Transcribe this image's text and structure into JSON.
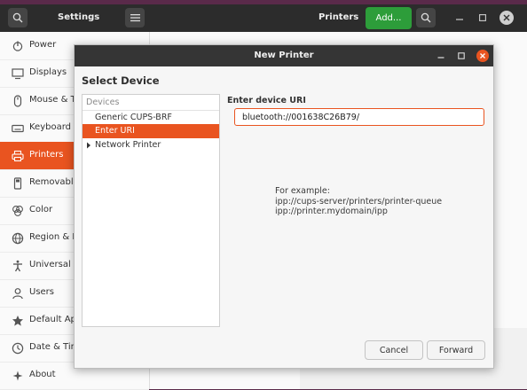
{
  "settings": {
    "title": "Settings",
    "page_title": "Printers",
    "add_label": "Add...",
    "sidebar": [
      {
        "label": "Power",
        "icon": "power-icon"
      },
      {
        "label": "Displays",
        "icon": "display-icon"
      },
      {
        "label": "Mouse & To",
        "icon": "mouse-icon"
      },
      {
        "label": "Keyboard S",
        "icon": "keyboard-icon"
      },
      {
        "label": "Printers",
        "icon": "printer-icon",
        "active": true
      },
      {
        "label": "Removable",
        "icon": "removable-media-icon"
      },
      {
        "label": "Color",
        "icon": "color-icon"
      },
      {
        "label": "Region & La",
        "icon": "region-icon"
      },
      {
        "label": "Universal A",
        "icon": "accessibility-icon"
      },
      {
        "label": "Users",
        "icon": "users-icon"
      },
      {
        "label": "Default Ap",
        "icon": "star-icon"
      },
      {
        "label": "Date & Tim",
        "icon": "clock-icon"
      },
      {
        "label": "About",
        "icon": "plus-icon"
      }
    ]
  },
  "dialog": {
    "title": "New Printer",
    "select_heading": "Select Device",
    "devices_header": "Devices",
    "devices": [
      {
        "label": "Generic CUPS-BRF"
      },
      {
        "label": "Enter URI",
        "selected": true
      },
      {
        "label": "Network Printer",
        "expandable": true
      }
    ],
    "uri_label": "Enter device URI",
    "uri_value": "bluetooth://001638C26B79/",
    "example_lines": [
      "For example:",
      "ipp://cups-server/printers/printer-queue",
      "ipp://printer.mydomain/ipp"
    ],
    "cancel_label": "Cancel",
    "forward_label": "Forward"
  },
  "colors": {
    "accent": "#e95420",
    "add_button": "#2d9d3a",
    "titlebar": "#2c2c2c"
  }
}
